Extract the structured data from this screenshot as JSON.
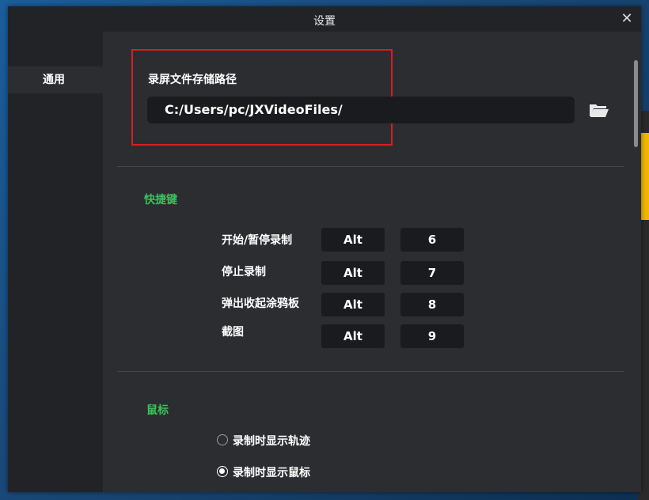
{
  "window": {
    "title": "设置",
    "close_glyph": "✕"
  },
  "sidebar": {
    "items": [
      {
        "label": "通用",
        "selected": true
      }
    ]
  },
  "storage": {
    "label": "录屏文件存储路径",
    "path": "C:/Users/pc/JXVideoFiles/",
    "browse_icon": "folder-open-icon"
  },
  "hotkeys": {
    "section_label": "快捷键",
    "items": [
      {
        "label": "开始/暂停录制",
        "modifier": "Alt",
        "key": "6"
      },
      {
        "label": "停止录制",
        "modifier": "Alt",
        "key": "7"
      },
      {
        "label": "弹出收起涂鸦板",
        "modifier": "Alt",
        "key": "8"
      },
      {
        "label": "截图",
        "modifier": "Alt",
        "key": "9"
      }
    ]
  },
  "mouse": {
    "section_label": "鼠标",
    "options": [
      {
        "label": "录制时显示轨迹",
        "checked": false
      },
      {
        "label": "录制时显示鼠标",
        "checked": true
      }
    ]
  },
  "colors": {
    "accent_green": "#3ac35a",
    "highlight_red": "#d81e1e",
    "background": "#2b2d31"
  }
}
